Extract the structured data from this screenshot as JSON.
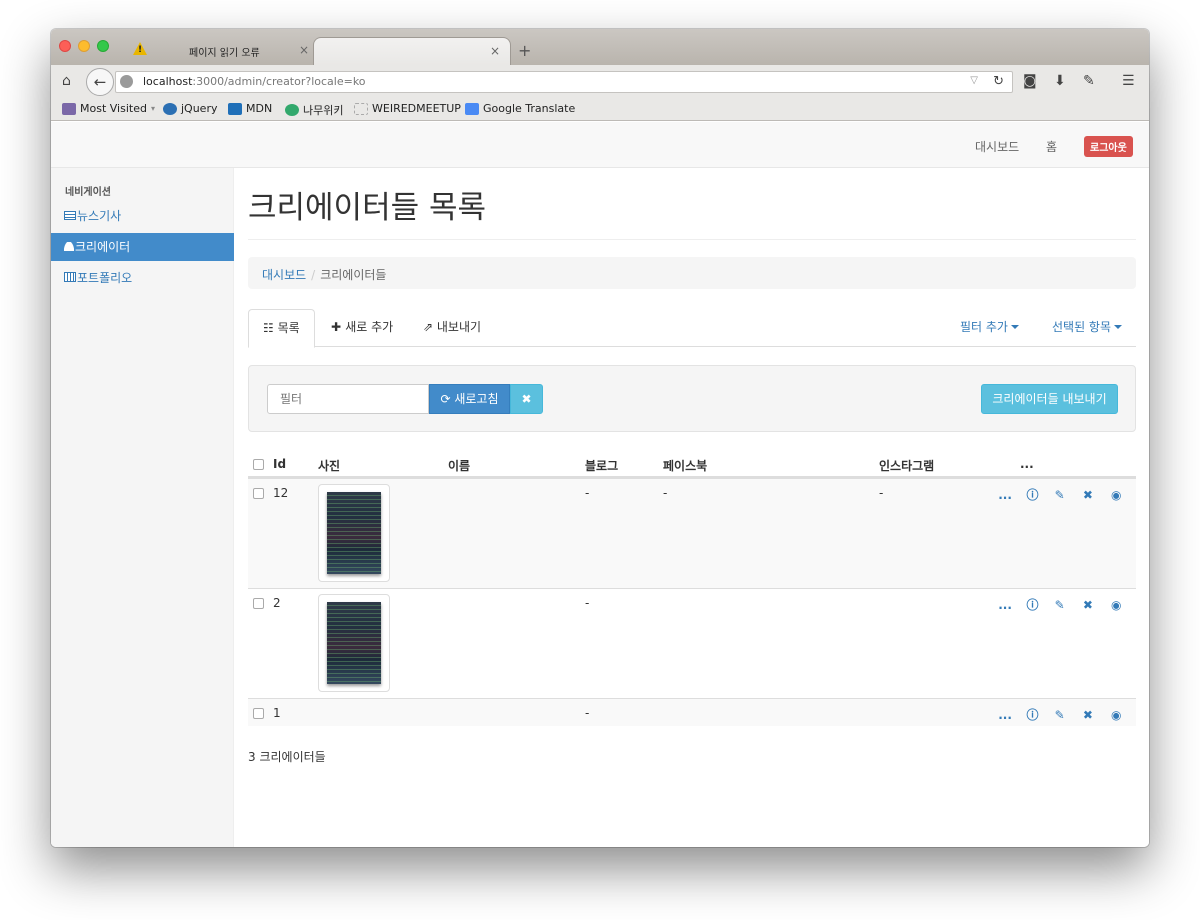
{
  "browser": {
    "tab_inactive_title": "페이지 읽기 오류",
    "tab_warning_glyph": "!",
    "tab_close": "×",
    "new_tab": "+",
    "url_host": "localhost",
    "url_path": ":3000/admin/creator?locale=ko",
    "bookmarks": [
      "Most Visited",
      "jQuery",
      "MDN",
      "나무위키",
      "WEIREDMEETUP",
      "Google Translate"
    ]
  },
  "topnav": {
    "dashboard": "대시보드",
    "home": "홈",
    "logout": "로그아웃"
  },
  "sidebar": {
    "heading": "네비게이션",
    "items": [
      {
        "label": "뉴스기사",
        "icon": "newspaper-icon"
      },
      {
        "label": "크리에이터",
        "icon": "user-icon"
      },
      {
        "label": "포트폴리오",
        "icon": "film-icon"
      }
    ]
  },
  "main": {
    "title": "크리에이터들 목록",
    "breadcrumb": {
      "root": "대시보드",
      "sep": "/",
      "current": "크리에이터들"
    },
    "tabs": {
      "list": "목록",
      "add": "새로 추가",
      "export": "내보내기",
      "add_filter": "필터 추가",
      "selected": "선택된 항목"
    },
    "filter": {
      "placeholder": "필터",
      "refresh": "새로고침",
      "clear": "✖",
      "export_button": "크리에이터들 내보내기"
    },
    "table": {
      "headers": {
        "id": "Id",
        "photo": "사진",
        "name": "이름",
        "blog": "블로그",
        "facebook": "페이스북",
        "instagram": "인스타그램",
        "more": "..."
      },
      "rows": [
        {
          "id": "12",
          "blog": "-",
          "facebook": "-",
          "instagram": "-"
        },
        {
          "id": "2",
          "blog": "-"
        },
        {
          "id": "1",
          "blog": "-"
        }
      ],
      "action_more": "..."
    },
    "count": "3 크리에이터들"
  },
  "colors": {
    "link": "#337ab7",
    "primary": "#428bca",
    "info": "#5bc0de",
    "danger": "#d9534f"
  }
}
